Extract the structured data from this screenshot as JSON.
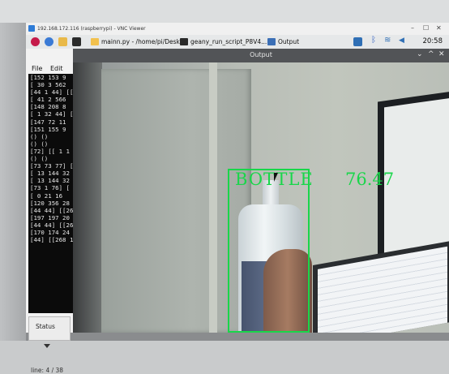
{
  "vnc": {
    "title": "192.168.172.116 (raspberrypi) - VNC Viewer",
    "controls": [
      "–",
      "☐",
      "✕"
    ]
  },
  "taskbar": {
    "tasks": [
      {
        "label": "mainn.py - /home/pi/Desk...",
        "color": "#f2c14e"
      },
      {
        "label": "geany_run_script_P8V4...",
        "color": "#2a2a2a"
      },
      {
        "label": "Output",
        "color": "#3b6fb6"
      }
    ],
    "clock": "20:58",
    "icons": [
      "raspberry-icon",
      "globe-icon",
      "folder-icon",
      "terminal-icon",
      "vnc-icon",
      "bluetooth-icon",
      "wifi-icon",
      "volume-icon"
    ]
  },
  "geany": {
    "menu": [
      "File",
      "Edit"
    ],
    "terminal_lines": [
      "[152 153  9",
      "[ 30   3 562",
      "[44  1 44] [[",
      "[ 41   2 566",
      "[148 208  8",
      "[ 1 32 44] [[",
      "[147  72 11",
      "[151 155  9",
      "() ()",
      "() ()",
      "[72] [[  1 1",
      "() ()",
      "[73 73 77] [",
      "[ 13 144 32",
      "[ 13 144 32",
      "[73  1 76] [",
      "[  0  21 16",
      "[120 356 28",
      "[44 44] [[26",
      "[197 197 20",
      "[44 44] [[26",
      "[170 174 24",
      "[44] [[268 1"
    ],
    "status_tab": "Status",
    "line_info": "line: 4 / 38"
  },
  "output": {
    "title": "Output",
    "controls": [
      "⌄",
      "^",
      "✕"
    ],
    "detection": {
      "label": "BOTTLE",
      "score": "76.47",
      "color": "#19d64a"
    }
  }
}
